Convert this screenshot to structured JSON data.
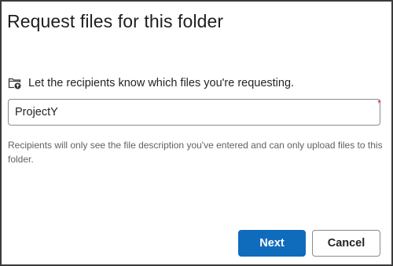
{
  "dialog": {
    "title": "Request files for this folder",
    "instruction": "Let the recipients know which files you're requesting.",
    "instruction_icon": "folder-upload-icon",
    "description_field": {
      "value": "ProjectY",
      "placeholder": "",
      "required_marker": "*"
    },
    "helper_text": "Recipients will only see the file description you've entered and can only upload files to this folder.",
    "buttons": {
      "next_label": "Next",
      "cancel_label": "Cancel"
    }
  },
  "colors": {
    "primary": "#0f6cbd",
    "required": "#c4314b",
    "border": "#3b3b3b"
  }
}
